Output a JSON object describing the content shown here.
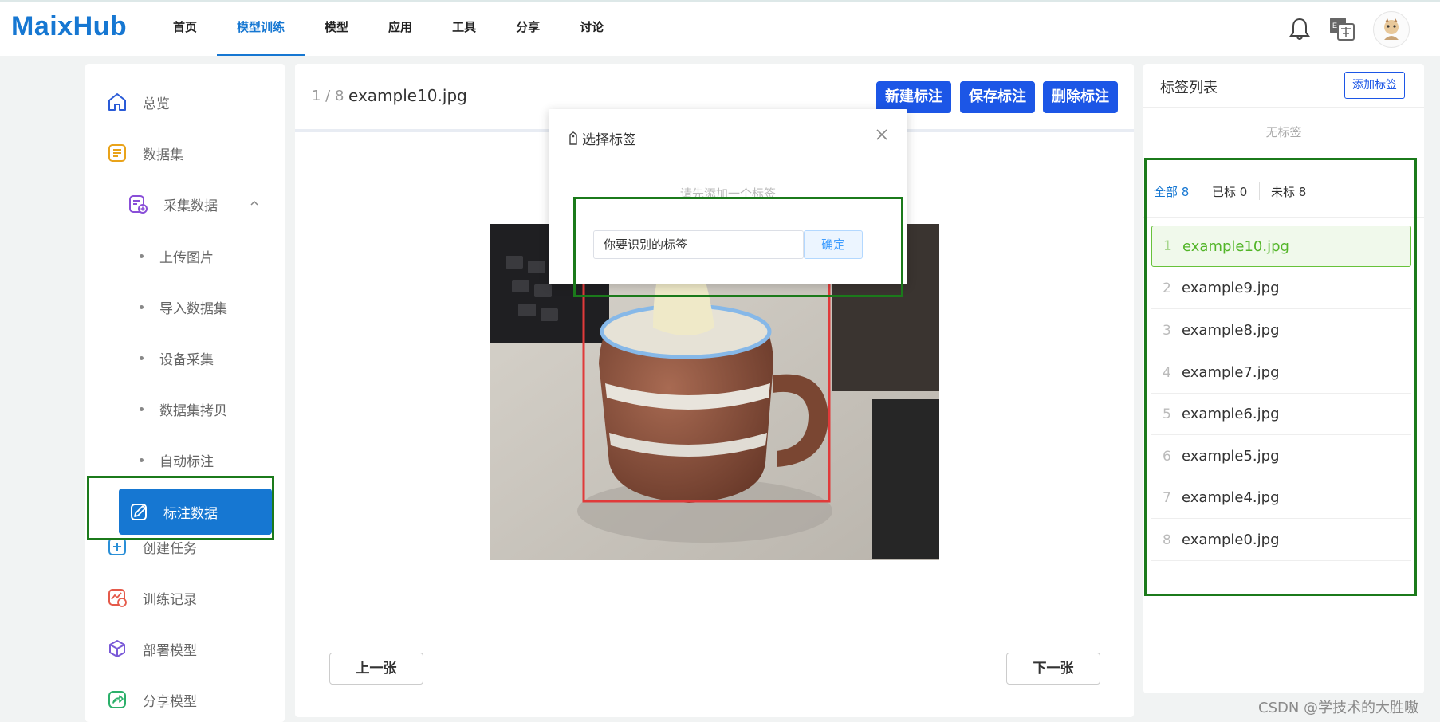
{
  "app": {
    "logo": "MaixHub",
    "nav": [
      {
        "label": "首页",
        "active": false
      },
      {
        "label": "模型训练",
        "active": true
      },
      {
        "label": "模型",
        "active": false
      },
      {
        "label": "应用",
        "active": false
      },
      {
        "label": "工具",
        "active": false
      },
      {
        "label": "分享",
        "active": false
      },
      {
        "label": "讨论",
        "active": false
      }
    ],
    "icons": [
      "bell-icon",
      "language-icon",
      "avatar"
    ]
  },
  "sidebar": {
    "items": [
      {
        "label": "总览",
        "icon": "home-icon"
      },
      {
        "label": "数据集",
        "icon": "dataset-icon"
      },
      {
        "label": "采集数据",
        "icon": "collect-data-icon",
        "expanded": true
      },
      {
        "label": "创建任务",
        "icon": "plus-square-icon"
      },
      {
        "label": "训练记录",
        "icon": "training-record-icon"
      },
      {
        "label": "部署模型",
        "icon": "cube-icon"
      },
      {
        "label": "分享模型",
        "icon": "share-icon"
      }
    ],
    "sub_items": [
      "上传图片",
      "导入数据集",
      "设备采集",
      "数据集拷贝",
      "自动标注"
    ],
    "active_item": {
      "label": "标注数据",
      "icon": "annotate-icon"
    }
  },
  "main": {
    "page_count": "1 / 8",
    "file_name": "example10.jpg",
    "buttons": {
      "new": "新建标注",
      "save": "保存标注",
      "delete": "删除标注"
    },
    "prev": "上一张",
    "next": "下一张"
  },
  "modal": {
    "title": "选择标签",
    "hint": "请先添加一个标签",
    "input_value": "你要识别的标签",
    "confirm": "确定"
  },
  "right": {
    "title": "标签列表",
    "add_tag": "添加标签",
    "no_tag": "无标签",
    "filters": [
      {
        "label": "全部",
        "count": "8",
        "active": true
      },
      {
        "label": "已标",
        "count": "0",
        "active": false
      },
      {
        "label": "未标",
        "count": "8",
        "active": false
      }
    ],
    "files": [
      {
        "idx": "1",
        "name": "example10.jpg",
        "active": true
      },
      {
        "idx": "2",
        "name": "example9.jpg",
        "active": false
      },
      {
        "idx": "3",
        "name": "example8.jpg",
        "active": false
      },
      {
        "idx": "4",
        "name": "example7.jpg",
        "active": false
      },
      {
        "idx": "5",
        "name": "example6.jpg",
        "active": false
      },
      {
        "idx": "6",
        "name": "example5.jpg",
        "active": false
      },
      {
        "idx": "7",
        "name": "example4.jpg",
        "active": false
      },
      {
        "idx": "8",
        "name": "example0.jpg",
        "active": false
      }
    ]
  },
  "watermark": "CSDN @学技术的大胜嗷",
  "colors": {
    "primary": "#1677d2",
    "button_blue": "#1c56e6",
    "bbox_red": "#e03a3a",
    "highlight_green": "#1b7a1b"
  }
}
